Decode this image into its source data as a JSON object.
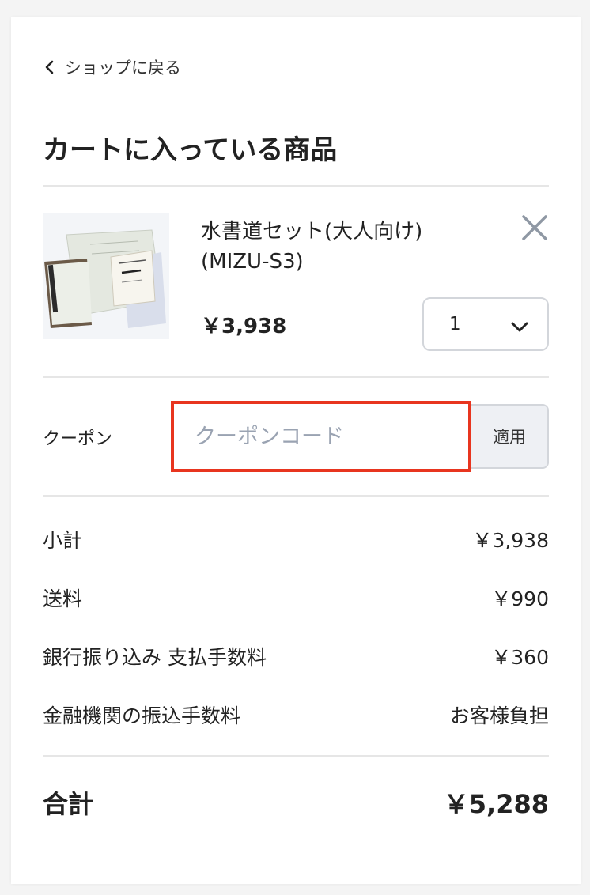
{
  "nav": {
    "back_label": "ショップに戻る"
  },
  "cart": {
    "title": "カートに入っている商品",
    "item": {
      "name": "水書道セット(大人向け) (MIZU-S3)",
      "price": "￥3,938",
      "quantity": "1"
    }
  },
  "coupon": {
    "label": "クーポン",
    "placeholder": "クーポンコード",
    "apply_label": "適用"
  },
  "summary": {
    "rows": [
      {
        "label": "小計",
        "value": "￥3,938"
      },
      {
        "label": "送料",
        "value": "￥990"
      },
      {
        "label": "銀行振り込み 支払手数料",
        "value": "￥360"
      },
      {
        "label": "金融機関の振込手数料",
        "value": "お客様負担"
      }
    ],
    "total_label": "合計",
    "total_value": "￥5,288"
  },
  "colors": {
    "highlight_border": "#e8351f",
    "placeholder": "#9aa3b2"
  }
}
